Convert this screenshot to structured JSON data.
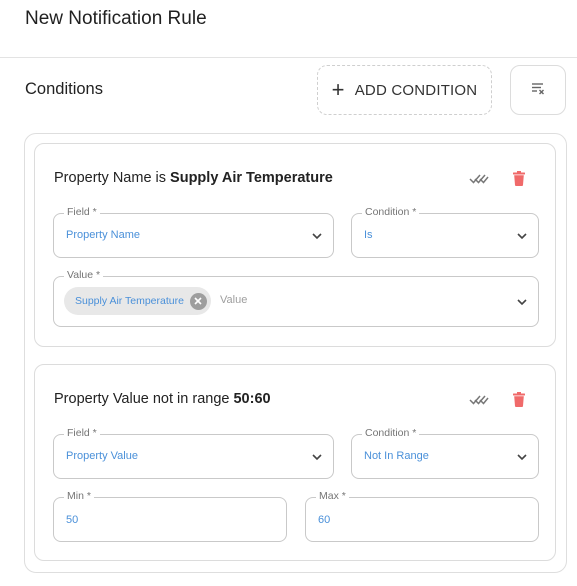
{
  "page": {
    "title": "New Notification Rule"
  },
  "conditions": {
    "section_title": "Conditions",
    "add_button_label": "ADD CONDITION",
    "clear_button_icon": "clear-all-icon"
  },
  "cards": [
    {
      "heading_prefix": "Property Name is ",
      "heading_bold": "Supply Air Temperature",
      "field_label": "Field *",
      "field_value": "Property Name",
      "condition_label": "Condition *",
      "condition_value": "Is",
      "value_label": "Value *",
      "value_chip": "Supply Air Temperature",
      "value_placeholder": "Value"
    },
    {
      "heading_prefix": "Property Value not in range ",
      "heading_bold": "50:60",
      "field_label": "Field *",
      "field_value": "Property Value",
      "condition_label": "Condition *",
      "condition_value": "Not In Range",
      "min_label": "Min *",
      "min_value": "50",
      "max_label": "Max *",
      "max_value": "60"
    }
  ],
  "colors": {
    "accent_value": "#4a90d9",
    "delete_icon": "#f06a6a",
    "border": "#c9c9c9"
  }
}
